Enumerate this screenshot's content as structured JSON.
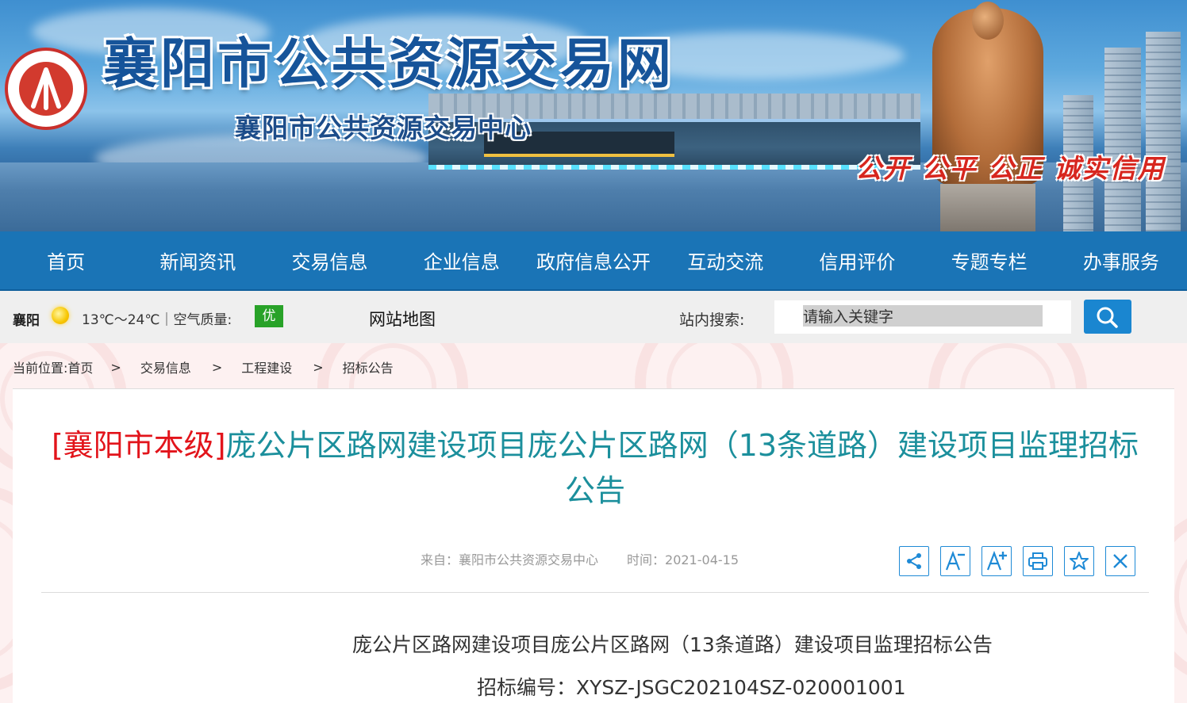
{
  "banner": {
    "title": "襄阳市公共资源交易网",
    "subtitle": "襄阳市公共资源交易中心",
    "motto": "公开 公平 公正 诚实信用"
  },
  "nav": {
    "items": [
      {
        "label": "首页"
      },
      {
        "label": "新闻资讯"
      },
      {
        "label": "交易信息"
      },
      {
        "label": "企业信息"
      },
      {
        "label": "政府信息公开"
      },
      {
        "label": "互动交流"
      },
      {
        "label": "信用评价"
      },
      {
        "label": "专题专栏"
      },
      {
        "label": "办事服务"
      }
    ]
  },
  "info_bar": {
    "city": "襄阳",
    "weather_icon": "sun-icon",
    "temperature": "13℃～24℃｜空气质量:",
    "air_quality": "优",
    "sitemap": "网站地图",
    "search_label": "站内搜索:",
    "search_placeholder": "请输入关键字"
  },
  "breadcrumb": {
    "prefix": "当前位置:",
    "items": [
      "首页",
      "交易信息",
      "工程建设",
      "招标公告"
    ],
    "separator": ">"
  },
  "article": {
    "title_tag": "[襄阳市本级]",
    "title": "庞公片区路网建设项目庞公片区路网（13条道路）建设项目监理招标公告",
    "source": "来自：襄阳市公共资源交易中心",
    "time": "时间：2021-04-15",
    "heading": "庞公片区路网建设项目庞公片区路网（13条道路）建设项目监理招标公告",
    "tender_no": "招标编号：XYSZ-JSGC202104SZ-020001001"
  },
  "tools": [
    "share-icon",
    "font-decrease-icon",
    "font-increase-icon",
    "print-icon",
    "favorite-icon",
    "close-icon"
  ],
  "colors": {
    "nav_bg": "#1a74b6",
    "title_teal": "#1b8f9c",
    "title_tag_red": "#e2141b",
    "aqi_green": "#28a228",
    "motto_red": "#d7261e",
    "search_button": "#1a86d0"
  }
}
